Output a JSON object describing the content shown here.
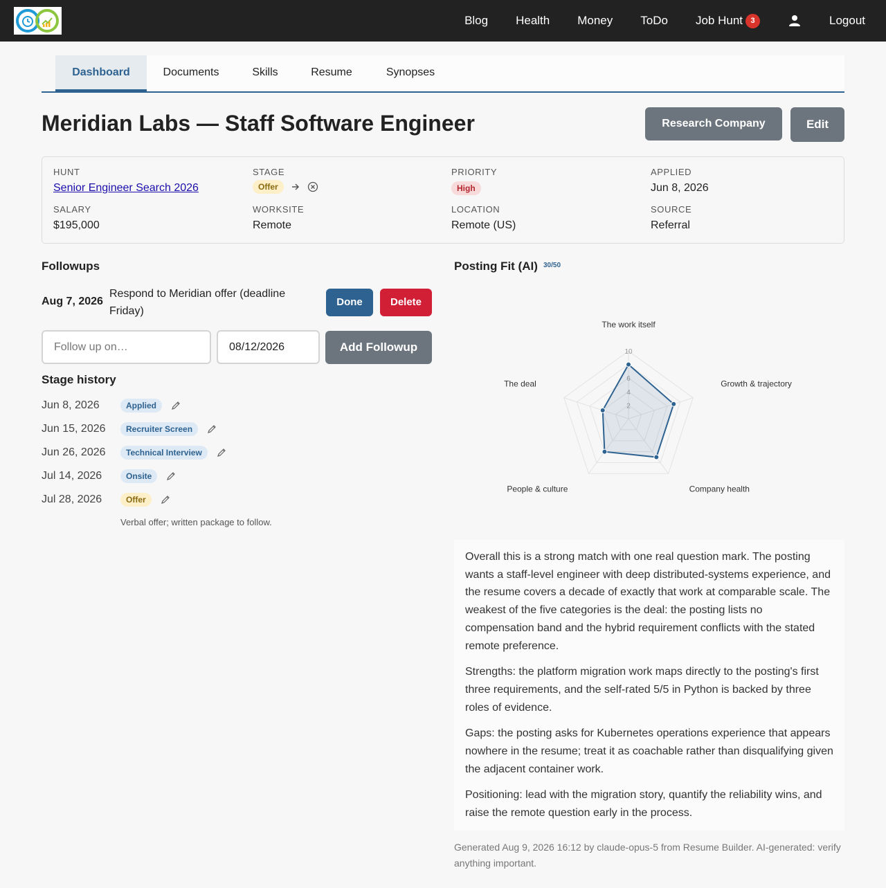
{
  "nav": {
    "links": [
      "Blog",
      "Health",
      "Money",
      "ToDo",
      "Job Hunt"
    ],
    "job_hunt_badge": "3",
    "logout": "Logout"
  },
  "tabs": [
    "Dashboard",
    "Documents",
    "Skills",
    "Resume",
    "Synopses"
  ],
  "page": {
    "title": "Meridian Labs — Staff Software Engineer",
    "research_button": "Research Company",
    "edit_button": "Edit"
  },
  "details": {
    "hunt_label": "HUNT",
    "hunt_value": "Senior Engineer Search 2026",
    "stage_label": "STAGE",
    "stage_value": "Offer",
    "priority_label": "PRIORITY",
    "priority_value": "High",
    "applied_label": "APPLIED",
    "applied_value": "Jun 8, 2026",
    "salary_label": "SALARY",
    "salary_value": "$195,000",
    "worksite_label": "WORKSITE",
    "worksite_value": "Remote",
    "location_label": "LOCATION",
    "location_value": "Remote (US)",
    "source_label": "SOURCE",
    "source_value": "Referral",
    "stage_color": "#fdf0c8",
    "priority_color": "#f9dada"
  },
  "followups": {
    "title": "Followups",
    "item_date": "Aug 7, 2026",
    "item_text": "Respond to Meridian offer (deadline Friday)",
    "done_button": "Done",
    "delete_button": "Delete",
    "placeholder": "Follow up on…",
    "date_value": "08/12/2026",
    "add_button": "Add Followup"
  },
  "stage_history": {
    "title": "Stage history",
    "rows": [
      {
        "date": "Jun 8, 2026",
        "stage": "Applied"
      },
      {
        "date": "Jun 15, 2026",
        "stage": "Recruiter Screen"
      },
      {
        "date": "Jun 26, 2026",
        "stage": "Technical Interview"
      },
      {
        "date": "Jul 14, 2026",
        "stage": "Onsite"
      },
      {
        "date": "Jul 28, 2026",
        "stage": "Offer"
      }
    ],
    "note": "Verbal offer; written package to follow."
  },
  "posting_fit": {
    "title": "Posting Fit (AI)",
    "score": "30/50",
    "summary": [
      "Overall this is a strong match with one real question mark. The posting wants a staff-level engineer with deep distributed-systems experience, and the resume covers a decade of exactly that work at comparable scale. The weakest of the five categories is the deal: the posting lists no compensation band and the hybrid requirement conflicts with the stated remote preference.",
      "Strengths: the platform migration work maps directly to the posting's first three requirements, and the self-rated 5/5 in Python is backed by three roles of evidence.",
      "Gaps: the posting asks for Kubernetes operations experience that appears nowhere in the resume; treat it as coachable rather than disqualifying given the adjacent container work.",
      "Positioning: lead with the migration story, quantify the reliability wins, and raise the remote question early in the process."
    ],
    "generated": "Generated Aug 9, 2026 16:12 by claude-opus-5 from Resume Builder. AI-generated: verify anything important."
  },
  "chart_data": {
    "type": "radar",
    "categories": [
      "The work itself",
      "Growth & trajectory",
      "Company health",
      "People & culture",
      "The deal"
    ],
    "values": [
      8,
      7,
      7,
      6,
      4
    ],
    "r_ticks": [
      "2",
      "4",
      "6",
      "10"
    ],
    "rlim": [
      0,
      10
    ],
    "color": "#2e6290"
  }
}
